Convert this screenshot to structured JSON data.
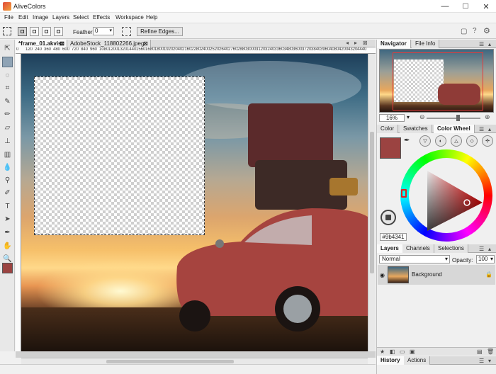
{
  "app": {
    "title": "AliveColors"
  },
  "window_controls": {
    "minimize": "—",
    "maximize": "☐",
    "close": "✕"
  },
  "menu": [
    "File",
    "Edit",
    "Image",
    "Layers",
    "Select",
    "Effects",
    "Workspace",
    "Help"
  ],
  "options": {
    "feather_label": "Feather",
    "feather_value": "0",
    "refine_label": "Refine Edges..."
  },
  "tabs": [
    {
      "label": "*frame_01.akvis",
      "close": "⊠"
    },
    {
      "label": "AdobeStock_118802266.jpeg",
      "close": "⊠"
    }
  ],
  "ruler": [
    "0",
    "120",
    "240",
    "360",
    "480",
    "600",
    "720",
    "840",
    "960",
    "1080",
    "1200",
    "1320",
    "1440",
    "1560",
    "1680",
    "1800",
    "1920",
    "2040",
    "2160",
    "2280",
    "2400",
    "2520",
    "2640",
    "2760",
    "2880",
    "3000",
    "3120",
    "3240",
    "3360",
    "3480",
    "3600",
    "3720",
    "3840",
    "3960",
    "4080",
    "4200",
    "4320",
    "4440"
  ],
  "navigator": {
    "tabs": [
      "Navigator",
      "File Info"
    ],
    "zoom": "16%"
  },
  "color": {
    "tabs": [
      "Color",
      "Swatches",
      "Color Wheel"
    ],
    "hex": "#9b4341",
    "current": "#9b4341"
  },
  "layers": {
    "tabs": [
      "Layers",
      "Channels",
      "Selections"
    ],
    "blend_mode": "Normal",
    "opacity_label": "Opacity:",
    "opacity_value": "100",
    "layer_name": "Background"
  },
  "bottom_tabs": [
    "History",
    "Actions"
  ]
}
